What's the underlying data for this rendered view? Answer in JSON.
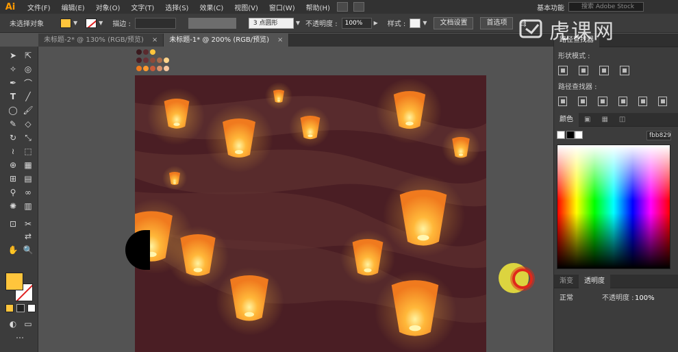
{
  "app": {
    "logo": "Ai",
    "menu": [
      "文件(F)",
      "编辑(E)",
      "对象(O)",
      "文字(T)",
      "选择(S)",
      "效果(C)",
      "视图(V)",
      "窗口(W)",
      "帮助(H)"
    ],
    "workspace": "基本功能",
    "stock_search_placeholder": "搜索 Adobe Stock"
  },
  "control_bar": {
    "selection_status": "未选择对象",
    "stroke_label": "描边 :",
    "brush": "3 点圆形",
    "opacity_label": "不透明度 :",
    "opacity_value": "100%",
    "style_label": "样式 :",
    "document_setup": "文档设置",
    "preferences": "首选项"
  },
  "tabs": [
    {
      "label": "未标题-2* @ 130% (RGB/预览)",
      "active": false
    },
    {
      "label": "未标题-1* @ 200% (RGB/预览)",
      "active": true
    }
  ],
  "colors": {
    "fill": "#ffc53c",
    "stroke": "#ffffff",
    "artboard_bg": "#4a1e24",
    "lantern_light": "#ffb83a",
    "lantern_dark": "#f07a1e"
  },
  "panels": {
    "pathfinder": {
      "title": "路径查找器",
      "shape_modes_label": "形状模式 :",
      "pathfinders_label": "路径查找器 :"
    },
    "color": {
      "title": "颜色",
      "hex": "fbb829"
    },
    "transparency": {
      "tabs": [
        "渐变",
        "透明度"
      ],
      "blend_mode": "正常",
      "opacity_label": "不透明度 :",
      "opacity_value": "100%"
    }
  },
  "watermark": {
    "text": "虎课网"
  }
}
